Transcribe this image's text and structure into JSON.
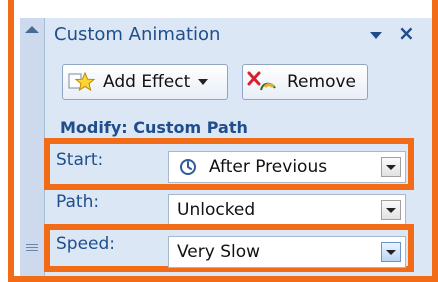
{
  "pane": {
    "title": "Custom Animation"
  },
  "toolbar": {
    "add_effect_label": "Add Effect",
    "remove_label": "Remove"
  },
  "section": {
    "modify_label": "Modify: Custom Path"
  },
  "fields": {
    "start": {
      "label": "Start:",
      "value": "After Previous"
    },
    "path": {
      "label": "Path:",
      "value": "Unlocked"
    },
    "speed": {
      "label": "Speed:",
      "value": "Very Slow"
    }
  },
  "colors": {
    "accent_orange": "#f26b16",
    "pane_background": "#dce7f5",
    "header_text": "#1f4e8c"
  },
  "icons": [
    "pane-scroll-up-icon",
    "dropdown-arrow-icon",
    "close-icon",
    "add-effect-star-icon",
    "remove-x-icon",
    "clock-icon"
  ]
}
